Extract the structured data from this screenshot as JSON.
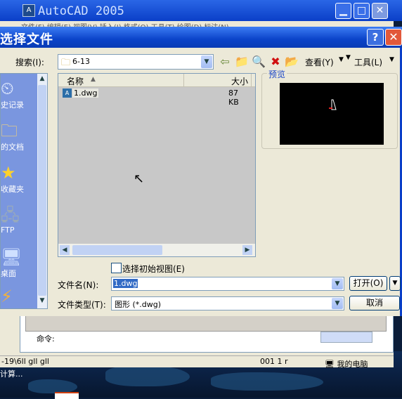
{
  "parent_window": {
    "title": "AutoCAD 2005",
    "menu_partial": "文件(F)  编辑(E)  视图(V)  插入(I)  格式(O)  工具(T)  绘图(D)  标注(N)",
    "command_label": "命令:",
    "status_left": "-19\\6ll  gll  gll",
    "status_mid": "001  1  r",
    "status_right": "我的电脑",
    "calc_text": "计算..."
  },
  "dialog": {
    "title": "选择文件",
    "search_label": "搜索(I):",
    "search_value": "6-13",
    "view_label": "查看(Y)",
    "tools_label": "工具(L)",
    "preview_label": "预览",
    "places": [
      {
        "label": "史记录",
        "icon": "history-icon"
      },
      {
        "label": "的文档",
        "icon": "my-documents-icon"
      },
      {
        "label": "收藏夹",
        "icon": "favorites-icon"
      },
      {
        "label": "FTP",
        "icon": "ftp-icon"
      },
      {
        "label": "桌面",
        "icon": "desktop-icon"
      },
      {
        "label": "",
        "icon": "buzzsaw-icon"
      }
    ],
    "columns": {
      "name": "名称",
      "size": "大小"
    },
    "files": [
      {
        "name": "1.dwg",
        "size": "87 KB"
      }
    ],
    "initial_view_checkbox": "选择初始视图(E)",
    "filename_label": "文件名(N):",
    "filename_value": "1.dwg",
    "filetype_label": "文件类型(T):",
    "filetype_value": "图形 (*.dwg)",
    "open_button": "打开(O)",
    "cancel_button": "取消"
  }
}
